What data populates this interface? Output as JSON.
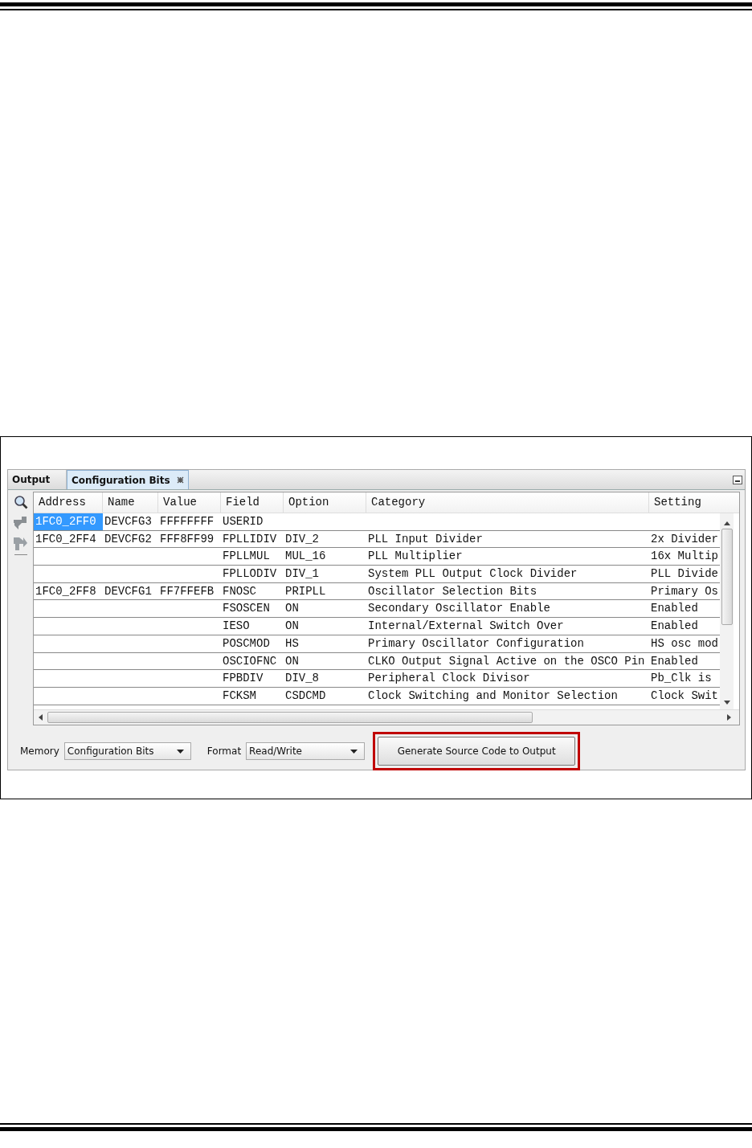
{
  "figure": {
    "tabs": [
      {
        "label": "Output",
        "selected": false,
        "closable": false
      },
      {
        "label": "Configuration Bits",
        "selected": true,
        "closable": true
      }
    ],
    "table": {
      "columns": [
        "Address",
        "Name",
        "Value",
        "Field",
        "Option",
        "Category",
        "Setting"
      ],
      "rows": [
        {
          "cells": [
            "1FC0_2FF0",
            "DEVCFG3",
            "FFFFFFFF",
            "USERID",
            "",
            "",
            ""
          ],
          "selected": true
        },
        {
          "cells": [
            "1FC0_2FF4",
            "DEVCFG2",
            "FFF8FF99",
            "FPLLIDIV",
            "DIV_2",
            "PLL Input Divider",
            "2x Divider"
          ],
          "selected": false
        },
        {
          "cells": [
            "",
            "",
            "",
            "FPLLMUL",
            "MUL_16",
            "PLL Multiplier",
            "16x Multip"
          ],
          "selected": false
        },
        {
          "cells": [
            "",
            "",
            "",
            "FPLLODIV",
            "DIV_1",
            "System PLL Output Clock Divider",
            "PLL Divide"
          ],
          "selected": false
        },
        {
          "cells": [
            "1FC0_2FF8",
            "DEVCFG1",
            "FF7FFEFB",
            "FNOSC",
            "PRIPLL",
            "Oscillator Selection Bits",
            "Primary Os"
          ],
          "selected": false
        },
        {
          "cells": [
            "",
            "",
            "",
            "FSOSCEN",
            "ON",
            "Secondary Oscillator Enable",
            "Enabled"
          ],
          "selected": false
        },
        {
          "cells": [
            "",
            "",
            "",
            "IESO",
            "ON",
            "Internal/External Switch Over",
            "Enabled"
          ],
          "selected": false
        },
        {
          "cells": [
            "",
            "",
            "",
            "POSCMOD",
            "HS",
            "Primary Oscillator Configuration",
            "HS osc mod"
          ],
          "selected": false
        },
        {
          "cells": [
            "",
            "",
            "",
            "OSCIOFNC",
            "ON",
            "CLKO Output Signal Active on the OSCO Pin",
            "Enabled"
          ],
          "selected": false
        },
        {
          "cells": [
            "",
            "",
            "",
            "FPBDIV",
            "DIV_8",
            "Peripheral Clock Divisor",
            "Pb_Clk is"
          ],
          "selected": false
        },
        {
          "cells": [
            "",
            "",
            "",
            "FCKSM",
            "CSDCMD",
            "Clock Switching and Monitor Selection",
            "Clock Swit"
          ],
          "selected": false
        }
      ]
    },
    "memory": {
      "label": "Memory",
      "value": "Configuration Bits"
    },
    "format": {
      "label": "Format",
      "value": "Read/Write"
    },
    "generate_button": {
      "label": "Generate Source Code to Output",
      "highlighted": true
    }
  }
}
